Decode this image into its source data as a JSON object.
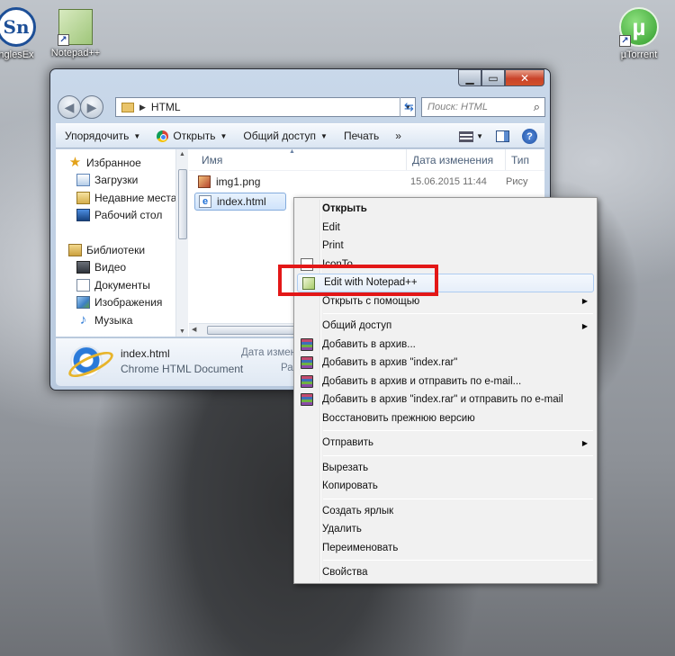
{
  "desktop": {
    "icons": [
      {
        "label": "nglesEx",
        "icon": "app-icon"
      },
      {
        "label": "Notepad++",
        "icon": "notepad-plus-plus-icon"
      },
      {
        "label": "µTorrent",
        "icon": "utorrent-icon"
      }
    ],
    "sn_glyph": "Sn",
    "ut_glyph": "µ"
  },
  "explorer": {
    "address": "HTML",
    "search_placeholder": "Поиск: HTML",
    "toolbar": {
      "organize": "Упорядочить",
      "open": "Открыть",
      "share": "Общий доступ",
      "print": "Печать",
      "more": "»"
    },
    "nav": {
      "favorites": "Избранное",
      "downloads": "Загрузки",
      "recent": "Недавние места",
      "desktop": "Рабочий стол",
      "libraries": "Библиотеки",
      "video": "Видео",
      "documents": "Документы",
      "images": "Изображения",
      "music": "Музыка"
    },
    "columns": {
      "name": "Имя",
      "date": "Дата изменения",
      "type": "Тип"
    },
    "files": [
      {
        "name": "img1.png",
        "date": "15.06.2015 11:44",
        "type": "Рису"
      },
      {
        "name": "index.html",
        "date": "",
        "type": ""
      }
    ],
    "details": {
      "name": "index.html",
      "type": "Chrome HTML Document",
      "date_label": "Дата измене",
      "size_label": "Ра"
    }
  },
  "context_menu": {
    "items": [
      {
        "label": "Открыть",
        "bold": true
      },
      {
        "label": "Edit"
      },
      {
        "label": "Print"
      },
      {
        "label": "IconTo"
      },
      {
        "label": "Edit with Notepad++",
        "highlighted": true
      },
      {
        "label": "Открыть с помощью",
        "submenu": true
      },
      {
        "label": "Общий доступ",
        "submenu": true
      },
      {
        "label": "Добавить в архив..."
      },
      {
        "label": "Добавить в архив \"index.rar\""
      },
      {
        "label": "Добавить в архив и отправить по e-mail..."
      },
      {
        "label": "Добавить в архив \"index.rar\" и отправить по e-mail"
      },
      {
        "label": "Восстановить прежнюю версию"
      },
      {
        "label": "Отправить",
        "submenu": true
      },
      {
        "label": "Вырезать"
      },
      {
        "label": "Копировать"
      },
      {
        "label": "Создать ярлык"
      },
      {
        "label": "Удалить"
      },
      {
        "label": "Переименовать"
      },
      {
        "label": "Свойства"
      }
    ]
  },
  "colors": {
    "highlight_box": "#e31717",
    "menu_hover_border": "#aeccf1",
    "window_frame": "#c9d8ea"
  }
}
